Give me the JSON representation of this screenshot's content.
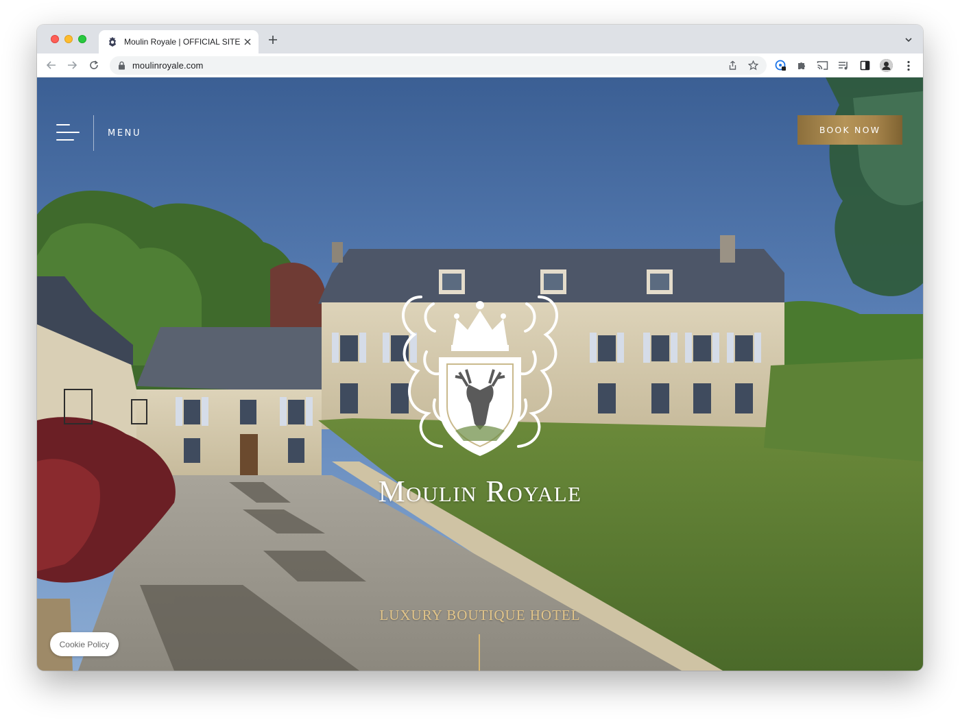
{
  "browser": {
    "tab_title": "Moulin Royale | OFFICIAL SITE",
    "url": "moulinroyale.com"
  },
  "site": {
    "menu_label": "MENU",
    "book_button": "BOOK NOW",
    "brand_name": "Moulin Royale",
    "tagline": "LUXURY BOUTIQUE HOTEL",
    "cookie_button": "Cookie Policy"
  },
  "colors": {
    "gold_accent": "#b59458",
    "tagline_gold": "#e2c58a",
    "chrome_tabstrip": "#dee1e6"
  },
  "icons": [
    "favicon-crest-icon",
    "close-icon",
    "plus-icon",
    "chevron-down-icon",
    "back-arrow-icon",
    "forward-arrow-icon",
    "reload-icon",
    "lock-icon",
    "share-icon",
    "star-icon",
    "extension-badge-icon",
    "puzzle-icon",
    "cast-icon",
    "media-queue-icon",
    "side-panel-icon",
    "profile-avatar-icon",
    "kebab-menu-icon",
    "hamburger-icon",
    "crest-logo-icon"
  ]
}
